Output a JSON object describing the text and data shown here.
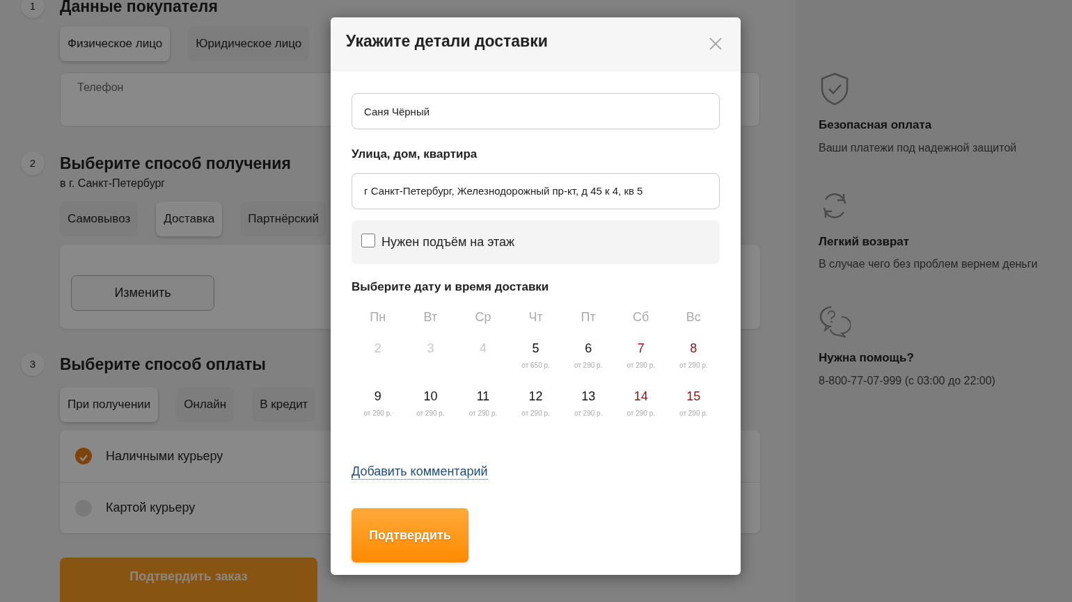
{
  "steps": [
    {
      "number": "1",
      "title": "Данные покупателя",
      "tabs": [
        {
          "label": "Физическое лицо",
          "selected": true
        },
        {
          "label": "Юридическое лицо",
          "selected": false
        }
      ],
      "phone_field": {
        "label": "Телефон"
      }
    },
    {
      "number": "2",
      "title": "Выберите способ получения",
      "subtitle": "в г. Санкт-Петербург",
      "tabs": [
        {
          "label": "Самовывоз",
          "selected": false
        },
        {
          "label": "Доставка",
          "selected": true
        },
        {
          "label": "Партнёрский",
          "selected": false
        }
      ],
      "change_button": "Изменить"
    },
    {
      "number": "3",
      "title": "Выберите способ оплаты",
      "tabs": [
        {
          "label": "При получении",
          "selected": true
        },
        {
          "label": "Онлайн",
          "selected": false
        },
        {
          "label": "В кредит",
          "selected": false
        }
      ],
      "options": [
        {
          "label": "Наличными курьеру",
          "selected": true
        },
        {
          "label": "Картой курьеру",
          "selected": false
        }
      ]
    }
  ],
  "submit_button": "Подтвердить заказ",
  "features": [
    {
      "title": "Безопасная оплата",
      "text": "Ваши платежи под надежной защитой"
    },
    {
      "title": "Легкий возврат",
      "text": "В случае чего без проблем вернем деньги"
    },
    {
      "title": "Нужна помощь?",
      "text": "8-800-77-07-999 (с 03:00 до 22:00)"
    }
  ],
  "modal": {
    "title": "Укажите детали доставки",
    "name_field": {
      "value": "Саня Чёрный"
    },
    "address_label": "Улица, дом, квартира",
    "address_field": {
      "value": "г Санкт-Петербург, Железнодорожный пр-кт, д 45 к 4, кв 5"
    },
    "lift_checkbox": {
      "label": "Нужен подъём на этаж",
      "checked": false
    },
    "calendar": {
      "title": "Выберите дату и время доставки",
      "weekdays": [
        "Пн",
        "Вт",
        "Ср",
        "Чт",
        "Пт",
        "Сб",
        "Вс"
      ],
      "days": [
        {
          "day": "2",
          "kind": "past"
        },
        {
          "day": "3",
          "kind": "past"
        },
        {
          "day": "4",
          "kind": "past"
        },
        {
          "day": "5",
          "kind": "workday",
          "price": "от 650 р."
        },
        {
          "day": "6",
          "kind": "workday",
          "price": "от 290 р."
        },
        {
          "day": "7",
          "kind": "weekend",
          "price": "от 290 р."
        },
        {
          "day": "8",
          "kind": "weekend",
          "price": "от 290 р."
        },
        {
          "day": "9",
          "kind": "workday",
          "price": "от 290 р."
        },
        {
          "day": "10",
          "kind": "workday",
          "price": "от 290 р."
        },
        {
          "day": "11",
          "kind": "workday",
          "price": "от 290 р."
        },
        {
          "day": "12",
          "kind": "workday",
          "price": "от 290 р."
        },
        {
          "day": "13",
          "kind": "workday",
          "price": "от 290 р."
        },
        {
          "day": "14",
          "kind": "weekend",
          "price": "от 290 р."
        },
        {
          "day": "15",
          "kind": "weekend",
          "price": "от 290 р."
        }
      ]
    },
    "comment_link": "Добавить комментарий",
    "confirm_button": "Подтвердить"
  }
}
